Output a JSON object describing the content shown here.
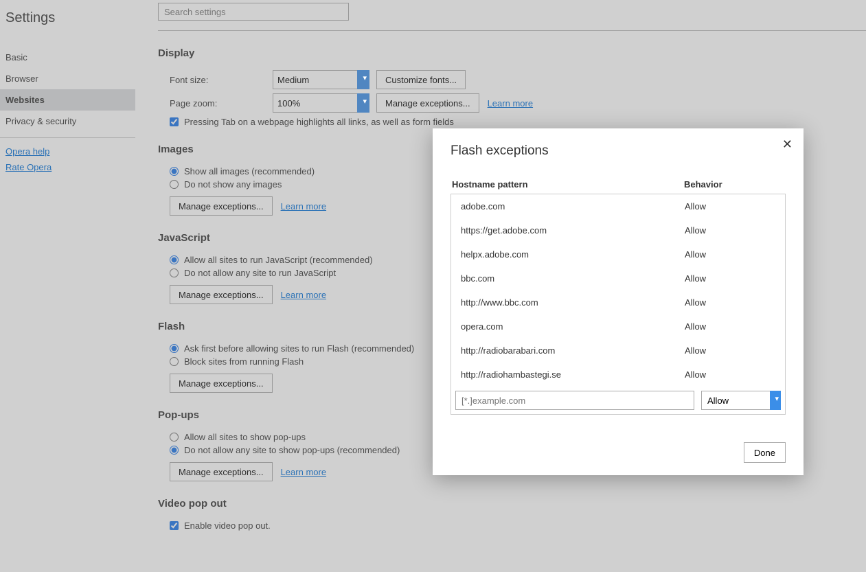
{
  "sidebar": {
    "title": "Settings",
    "items": [
      {
        "label": "Basic"
      },
      {
        "label": "Browser"
      },
      {
        "label": "Websites"
      },
      {
        "label": "Privacy & security"
      }
    ],
    "help": "Opera help",
    "rate": "Rate Opera"
  },
  "search": {
    "placeholder": "Search settings"
  },
  "display": {
    "title": "Display",
    "font_label": "Font size:",
    "font_value": "Medium",
    "customize": "Customize fonts...",
    "zoom_label": "Page zoom:",
    "zoom_value": "100%",
    "manage": "Manage exceptions...",
    "learn": "Learn more",
    "tab_check": "Pressing Tab on a webpage highlights all links, as well as form fields"
  },
  "images": {
    "title": "Images",
    "opt1": "Show all images (recommended)",
    "opt2": "Do not show any images",
    "manage": "Manage exceptions...",
    "learn": "Learn more"
  },
  "javascript": {
    "title": "JavaScript",
    "opt1": "Allow all sites to run JavaScript (recommended)",
    "opt2": "Do not allow any site to run JavaScript",
    "manage": "Manage exceptions...",
    "learn": "Learn more"
  },
  "flash": {
    "title": "Flash",
    "opt1": "Ask first before allowing sites to run Flash (recommended)",
    "opt2": "Block sites from running Flash",
    "manage": "Manage exceptions..."
  },
  "popups": {
    "title": "Pop-ups",
    "opt1": "Allow all sites to show pop-ups",
    "opt2": "Do not allow any site to show pop-ups (recommended)",
    "manage": "Manage exceptions...",
    "learn": "Learn more"
  },
  "videopop": {
    "title": "Video pop out",
    "check": "Enable video pop out."
  },
  "modal": {
    "title": "Flash exceptions",
    "col_host": "Hostname pattern",
    "col_beh": "Behavior",
    "rows": [
      {
        "host": "adobe.com",
        "beh": "Allow"
      },
      {
        "host": "https://get.adobe.com",
        "beh": "Allow"
      },
      {
        "host": "helpx.adobe.com",
        "beh": "Allow"
      },
      {
        "host": "bbc.com",
        "beh": "Allow"
      },
      {
        "host": "http://www.bbc.com",
        "beh": "Allow"
      },
      {
        "host": "opera.com",
        "beh": "Allow"
      },
      {
        "host": "http://radiobarabari.com",
        "beh": "Allow"
      },
      {
        "host": "http://radiohambastegi.se",
        "beh": "Allow"
      }
    ],
    "input_placeholder": "[*.]example.com",
    "select_value": "Allow",
    "done": "Done"
  }
}
